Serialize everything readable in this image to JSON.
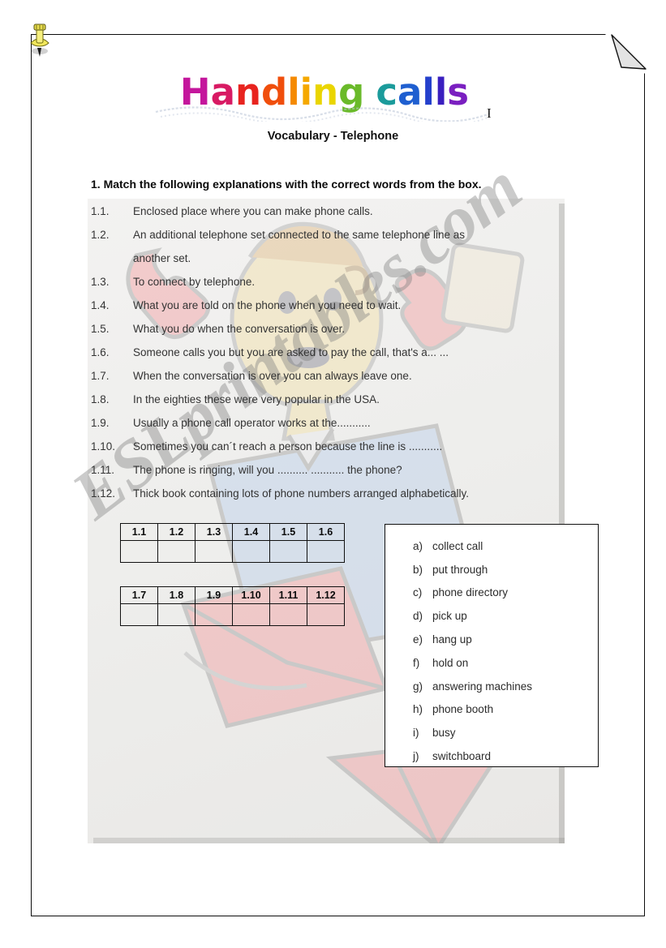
{
  "page": {
    "pushpin_icon": "pushpin-icon",
    "corner_fold_icon": "page-fold-corner-icon",
    "watermark_text": "ESLprintables.com"
  },
  "title": {
    "text": "Handling calls",
    "letters": [
      {
        "ch": "H",
        "color": "#c4169c"
      },
      {
        "ch": "a",
        "color": "#d81a63"
      },
      {
        "ch": "n",
        "color": "#e8241f"
      },
      {
        "ch": "d",
        "color": "#f04e0c"
      },
      {
        "ch": "l",
        "color": "#f58a00"
      },
      {
        "ch": "i",
        "color": "#f5a800"
      },
      {
        "ch": "n",
        "color": "#ead500"
      },
      {
        "ch": "g",
        "color": "#6aba2a"
      },
      {
        "ch": " ",
        "color": "#ffffff"
      },
      {
        "ch": "c",
        "color": "#1b9b9b"
      },
      {
        "ch": "a",
        "color": "#1f5fd0"
      },
      {
        "ch": "l",
        "color": "#2440cc"
      },
      {
        "ch": "l",
        "color": "#3a1fbf"
      },
      {
        "ch": "s",
        "color": "#7a1fc0"
      }
    ],
    "caret": "I",
    "subtitle": "Vocabulary - Telephone"
  },
  "task": {
    "heading": "1. Match the following explanations with the correct words from the box.",
    "questions": [
      {
        "num": "1.1.",
        "text": "Enclosed place where you can make phone calls.",
        "cont": ""
      },
      {
        "num": "1.2.",
        "text": "An additional telephone set connected to the same telephone line as",
        "cont": "another set."
      },
      {
        "num": "1.3.",
        "text": "To connect by telephone.",
        "cont": ""
      },
      {
        "num": "1.4.",
        "text": "What you are told on the phone when you need to wait.",
        "cont": ""
      },
      {
        "num": "1.5.",
        "text": "What you do when the conversation is over.",
        "cont": ""
      },
      {
        "num": "1.6.",
        "text": "Someone calls you but you are asked to pay the call, that's a... ...",
        "cont": ""
      },
      {
        "num": "1.7.",
        "text": "When the conversation is over you can always leave one.",
        "cont": ""
      },
      {
        "num": "1.8.",
        "text": "In the eighties these were very popular in the USA.",
        "cont": ""
      },
      {
        "num": "1.9.",
        "text": "Usually a phone call operator works at the...........",
        "cont": ""
      },
      {
        "num": "1.10.",
        "text": "Sometimes you can´t reach a person because the line is ...........",
        "cont": ""
      },
      {
        "num": "1.11.",
        "text": "The phone is ringing, will you .......... ........... the phone?",
        "cont": ""
      },
      {
        "num": "1.12.",
        "text": "Thick book containing lots of phone numbers arranged alphabetically.",
        "cont": ""
      }
    ]
  },
  "answer_tables": [
    {
      "headers": [
        "1.1",
        "1.2",
        "1.3",
        "1.4",
        "1.5",
        "1.6"
      ],
      "answers": [
        "",
        "",
        "",
        "",
        "",
        ""
      ]
    },
    {
      "headers": [
        "1.7",
        "1.8",
        "1.9",
        "1.10",
        "1.11",
        "1.12"
      ],
      "answers": [
        "",
        "",
        "",
        "",
        "",
        ""
      ]
    }
  ],
  "word_box": {
    "options": [
      {
        "letter": "a)",
        "word": "collect call"
      },
      {
        "letter": "b)",
        "word": "put through"
      },
      {
        "letter": "c)",
        "word": "phone directory"
      },
      {
        "letter": "d)",
        "word": "pick up"
      },
      {
        "letter": "e)",
        "word": "hang up"
      },
      {
        "letter": "f)",
        "word": "hold on"
      },
      {
        "letter": "g)",
        "word": "answering machines"
      },
      {
        "letter": "h)",
        "word": "phone booth"
      },
      {
        "letter": "i)",
        "word": "busy"
      },
      {
        "letter": "j)",
        "word": "switchboard"
      }
    ]
  }
}
